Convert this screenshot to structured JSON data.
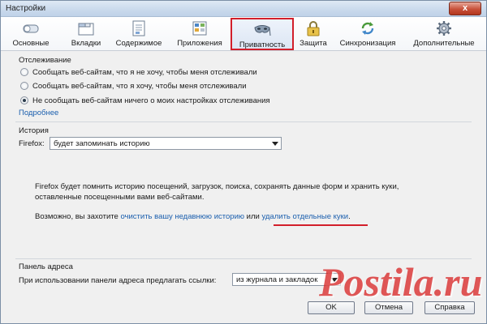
{
  "window": {
    "title": "Настройки",
    "close_glyph": "x"
  },
  "toolbar": {
    "tabs": [
      {
        "label": "Основные",
        "icon": "toggle-switch-icon"
      },
      {
        "label": "Вкладки",
        "icon": "tabs-icon"
      },
      {
        "label": "Содержимое",
        "icon": "document-icon"
      },
      {
        "label": "Приложения",
        "icon": "applications-icon"
      },
      {
        "label": "Приватность",
        "icon": "mask-icon"
      },
      {
        "label": "Защита",
        "icon": "lock-icon"
      },
      {
        "label": "Синхронизация",
        "icon": "sync-icon"
      },
      {
        "label": "Дополнительные",
        "icon": "gear-icon"
      }
    ],
    "active_index": 4,
    "highlight_color": "#d21f2b"
  },
  "tracking": {
    "heading": "Отслеживание",
    "options": [
      {
        "label": "Сообщать веб-сайтам, что я не хочу, чтобы меня отслеживали",
        "checked": false
      },
      {
        "label": "Сообщать веб-сайтам, что я хочу, чтобы меня отслеживали",
        "checked": false
      },
      {
        "label": "Не сообщать веб-сайтам ничего о моих настройках отслеживания",
        "checked": true
      }
    ],
    "more_link": "Подробнее"
  },
  "history": {
    "heading": "История",
    "firefox_label": "Firefox:",
    "mode_value": "будет запоминать историю",
    "description": "Firefox будет помнить историю посещений, загрузок, поиска, сохранять данные форм и хранить куки, оставленные посещенными вами веб-сайтами.",
    "hint_prefix": "Возможно, вы захотите",
    "clear_link": "очистить вашу недавнюю историю",
    "hint_or": "или",
    "cookies_link": "удалить отдельные куки",
    "hint_suffix": "."
  },
  "address_bar": {
    "heading": "Панель адреса",
    "label": "При использовании панели адреса предлагать ссылки:",
    "value": "из журнала и закладок"
  },
  "buttons": {
    "ok": "OK",
    "cancel": "Отмена",
    "help": "Справка"
  },
  "watermark": {
    "text": "Postila.ru",
    "color": "#d72828"
  },
  "colors": {
    "link": "#1b5fae",
    "accent_red": "#d21f2b"
  }
}
